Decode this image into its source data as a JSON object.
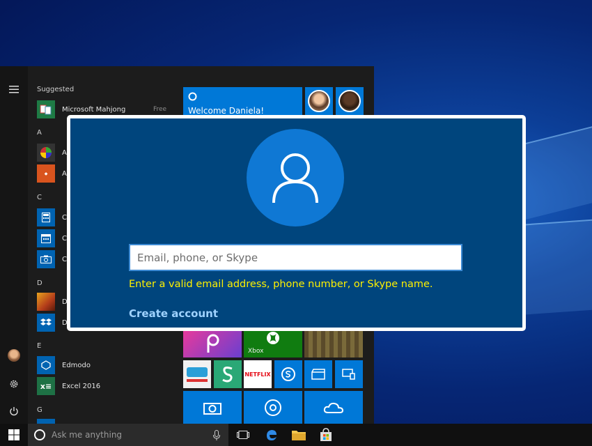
{
  "start_menu": {
    "suggested_label": "Suggested",
    "suggested_app": {
      "name": "Microsoft Mahjong",
      "badge": "Free",
      "icon": "mahjong-icon",
      "color": "#1e7b45"
    },
    "groups": [
      {
        "letter": "A"
      },
      {
        "letter": "C"
      },
      {
        "letter": "D"
      },
      {
        "letter": "E"
      },
      {
        "letter": "G"
      }
    ],
    "apps": [
      {
        "name": "A",
        "icon": "color-wheel-icon",
        "color": "#333333"
      },
      {
        "name": "A",
        "icon": "shrapp-icon",
        "color": "#d9541e"
      },
      {
        "name": "C",
        "icon": "calculator-icon",
        "color": "#0063b1"
      },
      {
        "name": "C",
        "icon": "calendar-icon",
        "color": "#0063b1"
      },
      {
        "name": "C",
        "icon": "camera-icon",
        "color": "#0063b1"
      },
      {
        "name": "D",
        "icon": "game-icon",
        "color": "#b33c1a"
      },
      {
        "name": "D",
        "icon": "dropbox-icon",
        "color": "#0063b1"
      },
      {
        "name": "Edmodo",
        "icon": "edmodo-icon",
        "color": "#0063b1"
      },
      {
        "name": "Excel 2016",
        "icon": "excel-icon",
        "color": "#1e7145"
      }
    ],
    "welcome_tile": "Welcome Daniela!",
    "xbox_label": "Xbox",
    "netflix_label": "NETFLIX"
  },
  "signin": {
    "email_placeholder": "Email, phone, or Skype",
    "email_value": "",
    "error_text": "Enter a valid email address, phone number, or Skype name.",
    "create_account_label": "Create account",
    "user_icon": "user-icon"
  },
  "taskbar": {
    "search_placeholder": "Ask me anything"
  },
  "colors": {
    "dialog_bg": "#00457d",
    "avatar_circle": "#0f78d4",
    "error": "#fff000",
    "link": "#9fd2ff",
    "tile_blue": "#0078d7"
  }
}
